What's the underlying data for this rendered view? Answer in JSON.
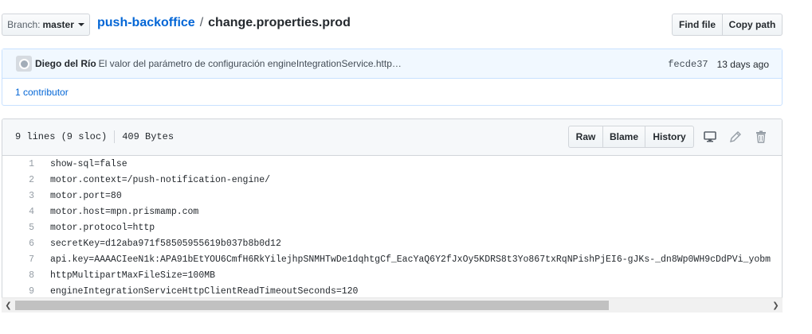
{
  "top": {
    "branch_label": "Branch:",
    "branch_value": "master",
    "repo": "push-backoffice",
    "separator": "/",
    "file": "change.properties.prod",
    "find_file": "Find file",
    "copy_path": "Copy path"
  },
  "commit": {
    "author": "Diego del Río",
    "message": "El valor del parámetro de configuración engineIntegrationService.http…",
    "sha": "fecde37",
    "ago": "13 days ago",
    "contributors": "1 contributor"
  },
  "file": {
    "lines_info": "9 lines (9 sloc)",
    "size": "409 Bytes",
    "raw": "Raw",
    "blame": "Blame",
    "history": "History",
    "icons": [
      "desktop-icon",
      "pencil-icon",
      "trash-icon"
    ]
  },
  "code_lines": [
    {
      "n": "1",
      "text": "show-sql=false"
    },
    {
      "n": "2",
      "text": "motor.context=/push-notification-engine/"
    },
    {
      "n": "3",
      "text": "motor.port=80"
    },
    {
      "n": "4",
      "text": "motor.host=mpn.prismamp.com"
    },
    {
      "n": "5",
      "text": "motor.protocol=http"
    },
    {
      "n": "6",
      "text": "secretKey=d12aba971f58505955619b037b8b0d12"
    },
    {
      "n": "7",
      "text": "api.key=AAAACIeeN1k:APA91bEtYOU6CmfH6RkYilejhpSNMHTwDe1dqhtgCf_EacYaQ6Y2fJxOy5KDRS8t3Yo867txRqNPishPjEI6-gJKs-_dn8Wp0WH9cDdPVi_yobm"
    },
    {
      "n": "8",
      "text": "httpMultipartMaxFileSize=100MB"
    },
    {
      "n": "9",
      "text": "engineIntegrationServiceHttpClientReadTimeoutSeconds=120"
    }
  ],
  "colors": {
    "link": "#0366d6",
    "commit_bg": "#f1f8ff",
    "header_bg": "#f6f8fa"
  }
}
